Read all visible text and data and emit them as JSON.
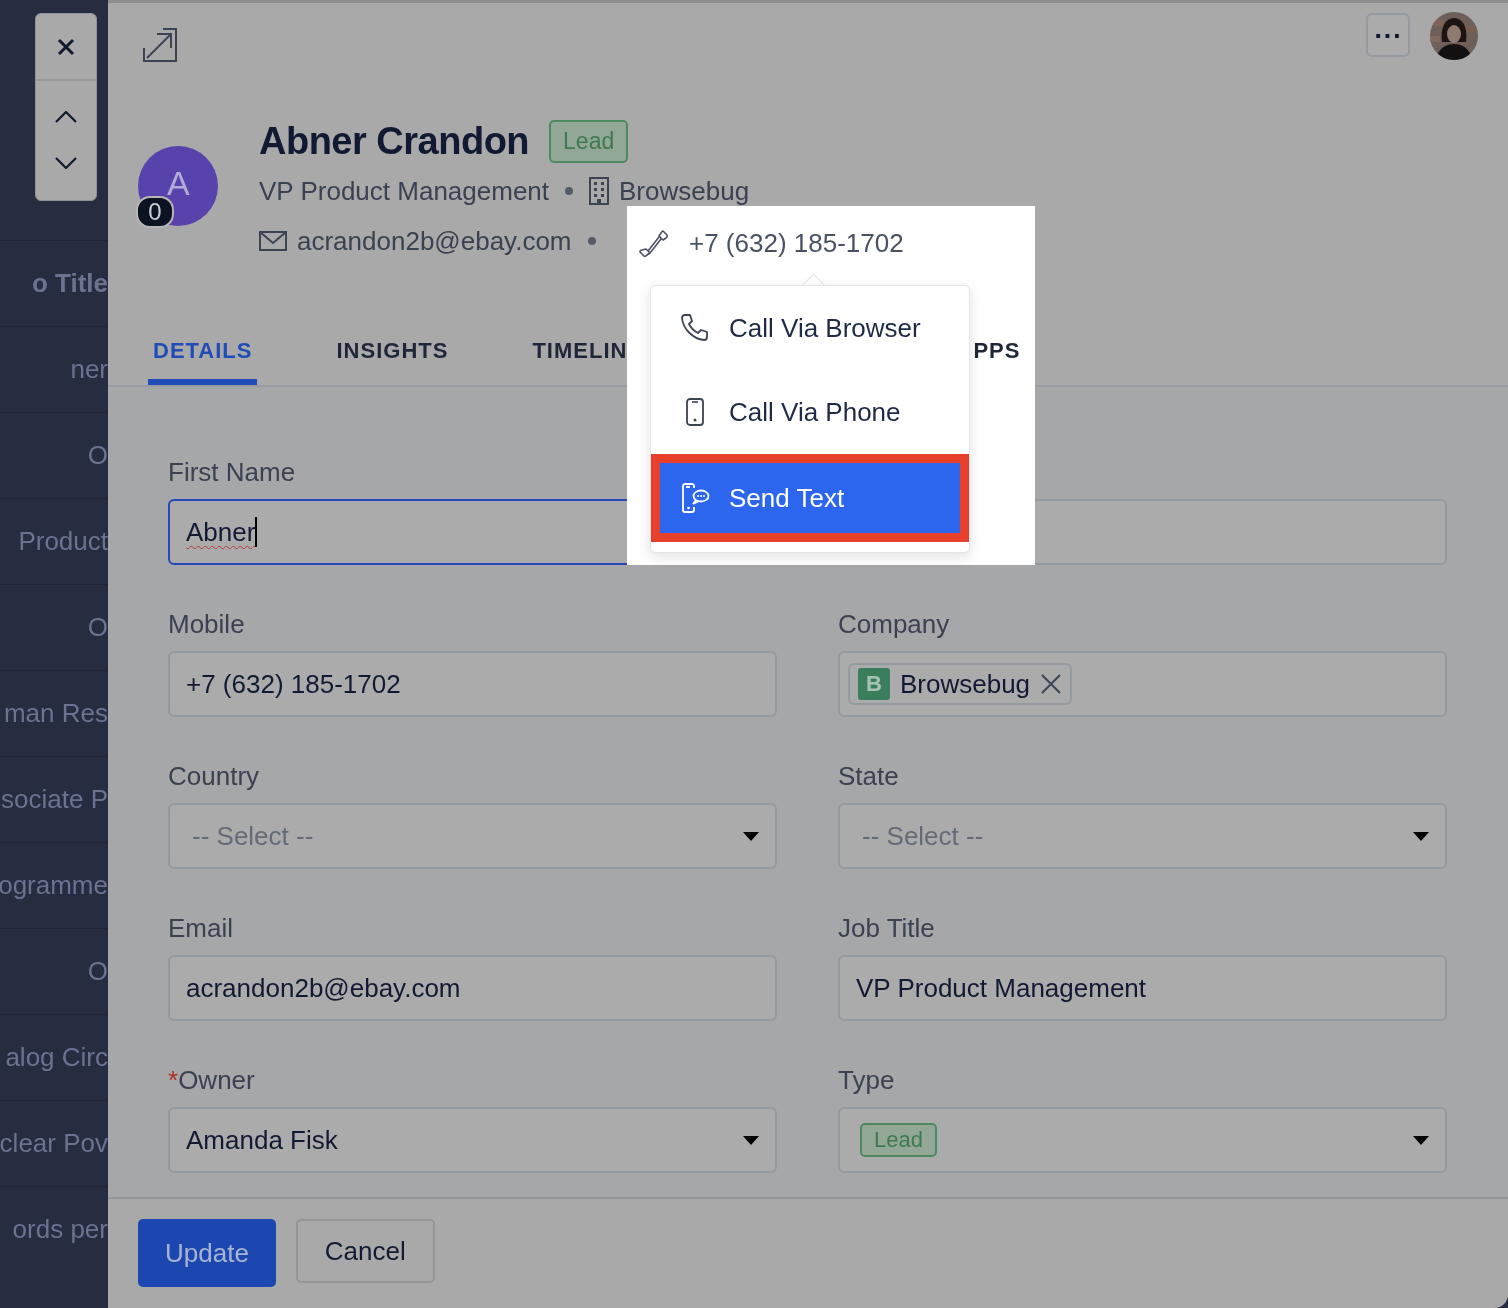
{
  "background_list": {
    "items": [
      {
        "label": "o Title",
        "kind": "heading"
      },
      {
        "label": "ner",
        "kind": "cell"
      },
      {
        "label": "O",
        "kind": "cell"
      },
      {
        "label": "Product",
        "kind": "cell"
      },
      {
        "label": "O",
        "kind": "cell"
      },
      {
        "label": "man Res",
        "kind": "cell"
      },
      {
        "label": "sociate P",
        "kind": "cell"
      },
      {
        "label": "ogramme",
        "kind": "cell"
      },
      {
        "label": "O",
        "kind": "cell"
      },
      {
        "label": "alog Circ",
        "kind": "cell"
      },
      {
        "label": "clear Pov",
        "kind": "cell"
      },
      {
        "label": "ords per",
        "kind": "cell"
      }
    ]
  },
  "more_button": {
    "label": "..."
  },
  "header": {
    "avatar_letter": "A",
    "avatar_count": "0",
    "name": "Abner Crandon",
    "badge": "Lead",
    "job_title": "VP Product Management",
    "company": "Browsebug",
    "email": "acrandon2b@ebay.com"
  },
  "tabs": [
    {
      "label": "DETAILS",
      "selected": true
    },
    {
      "label": "INSIGHTS",
      "selected": false
    },
    {
      "label": "TIMELIN",
      "selected": false
    },
    {
      "label": "PPS",
      "selected": false
    }
  ],
  "form": {
    "fields": [
      {
        "kind": "text",
        "label": "First Name",
        "value": "Abner",
        "focused": true
      },
      {
        "kind": "text",
        "focused": false
      },
      {
        "kind": "text",
        "label": "Mobile",
        "value": "+7 (632) 185-1702",
        "focused": false
      },
      {
        "kind": "tags",
        "label": "Company",
        "tags": [
          {
            "letter": "B",
            "label": "Browsebug"
          }
        ],
        "focused": false
      },
      {
        "kind": "select",
        "label": "Country",
        "placeholder": "-- Select --",
        "focused": false
      },
      {
        "kind": "select",
        "label": "State",
        "placeholder": "-- Select --",
        "focused": false
      },
      {
        "kind": "text",
        "label": "Email",
        "value": "acrandon2b@ebay.com",
        "focused": false
      },
      {
        "kind": "text",
        "label": "Job Title",
        "value": "VP Product Management",
        "focused": false
      },
      {
        "kind": "select",
        "label": "Owner",
        "required": true,
        "required_mark": "*",
        "value": "Amanda Fisk",
        "focused": false
      },
      {
        "kind": "select",
        "label": "Type",
        "tag": "Lead",
        "focused": false
      }
    ]
  },
  "phone": {
    "number": "+7 (632) 185-1702"
  },
  "phone_menu": {
    "items": [
      {
        "kind": "browser",
        "label": "Call Via Browser",
        "selected": false
      },
      {
        "kind": "phone",
        "label": "Call Via Phone",
        "selected": false
      },
      {
        "kind": "text",
        "label": "Send Text",
        "selected": true
      }
    ]
  },
  "footer": {
    "buttons": [
      {
        "kind": "primary",
        "label": "Update"
      },
      {
        "kind": "secondary",
        "label": "Cancel"
      }
    ]
  }
}
